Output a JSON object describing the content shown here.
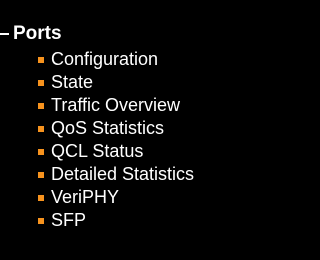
{
  "nav": {
    "section_title": "Ports",
    "items": [
      {
        "label": "Configuration"
      },
      {
        "label": "State"
      },
      {
        "label": "Traffic Overview"
      },
      {
        "label": "QoS Statistics"
      },
      {
        "label": "QCL Status"
      },
      {
        "label": "Detailed Statistics"
      },
      {
        "label": "VeriPHY"
      },
      {
        "label": "SFP"
      }
    ]
  },
  "colors": {
    "background": "#000000",
    "text": "#ffffff",
    "bullet": "#f7931e"
  }
}
